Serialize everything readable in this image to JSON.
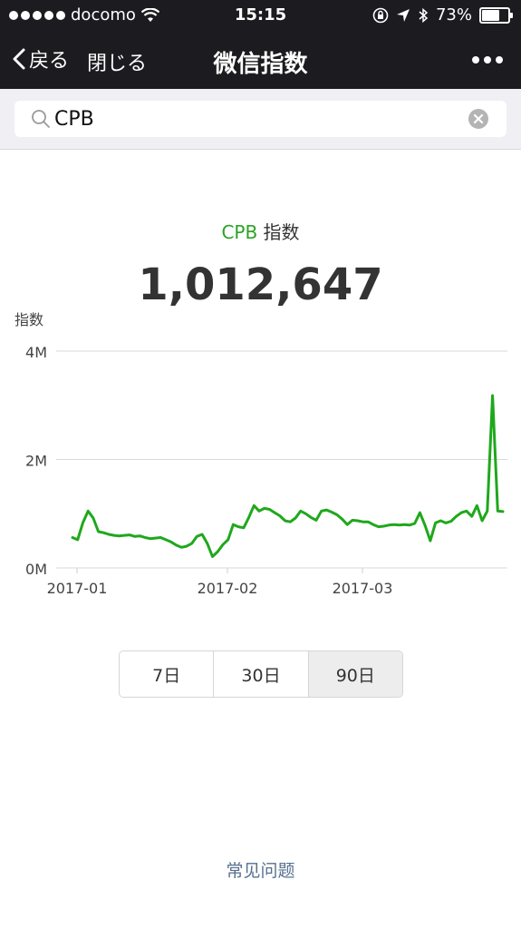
{
  "status_bar": {
    "carrier": "docomo",
    "time": "15:15",
    "battery_percent": "73%",
    "battery_level": 0.73
  },
  "nav": {
    "back_label": "戻る",
    "close_label": "閉じる",
    "title": "微信指数"
  },
  "search": {
    "value": "CPB"
  },
  "summary": {
    "keyword": "CPB",
    "suffix": "指数",
    "value": "1,012,647"
  },
  "chart_data": {
    "type": "line",
    "ylabel": "指数",
    "y_ticks": [
      "4M",
      "2M",
      "0M"
    ],
    "ylim": [
      0,
      4000000
    ],
    "x_ticks": [
      "2017-01",
      "2017-02",
      "2017-03"
    ],
    "grid": true,
    "color": "#1fa81c",
    "series": [
      {
        "values": [
          560000,
          520000,
          830000,
          1050000,
          920000,
          670000,
          650000,
          620000,
          600000,
          590000,
          600000,
          610000,
          580000,
          590000,
          560000,
          540000,
          550000,
          560000,
          520000,
          480000,
          420000,
          380000,
          400000,
          450000,
          580000,
          620000,
          450000,
          210000,
          300000,
          430000,
          520000,
          800000,
          760000,
          740000,
          930000,
          1150000,
          1050000,
          1100000,
          1080000,
          1020000,
          960000,
          870000,
          850000,
          920000,
          1050000,
          1000000,
          930000,
          880000,
          1050000,
          1070000,
          1030000,
          980000,
          900000,
          800000,
          880000,
          870000,
          850000,
          850000,
          800000,
          760000,
          770000,
          790000,
          800000,
          790000,
          800000,
          790000,
          820000,
          1020000,
          780000,
          500000,
          830000,
          870000,
          830000,
          860000,
          950000,
          1020000,
          1050000,
          950000,
          1150000,
          870000,
          1050000,
          3180000,
          1050000,
          1040000
        ]
      }
    ]
  },
  "range_options": [
    {
      "label": "7日",
      "active": false
    },
    {
      "label": "30日",
      "active": false
    },
    {
      "label": "90日",
      "active": true
    }
  ],
  "footer": {
    "faq_label": "常见问题"
  }
}
